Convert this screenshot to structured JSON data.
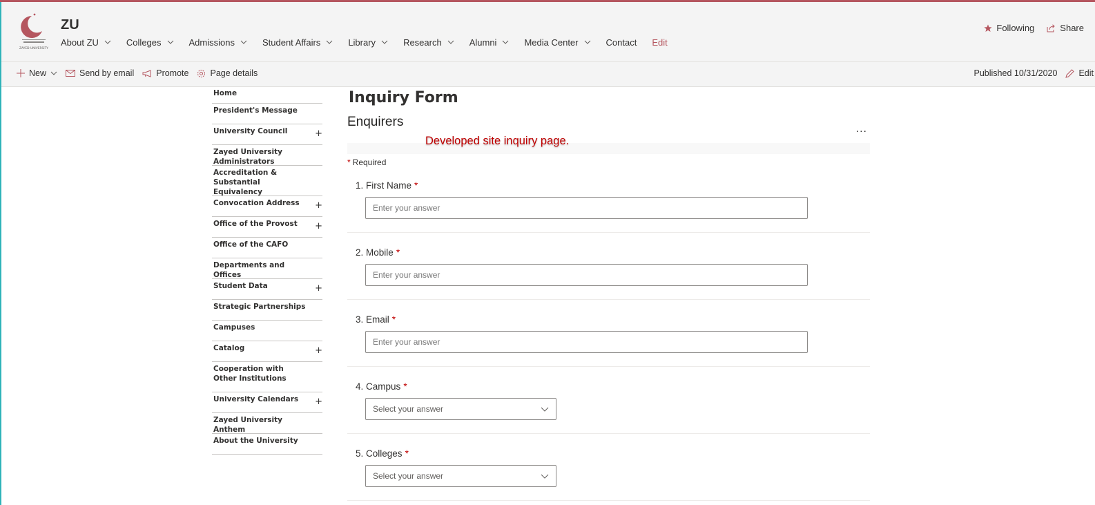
{
  "site": {
    "logo_caption": "ZAYED UNIVERSITY",
    "title": "ZU"
  },
  "nav": {
    "items": [
      {
        "label": "About ZU",
        "dropdown": true
      },
      {
        "label": "Colleges",
        "dropdown": true
      },
      {
        "label": "Admissions",
        "dropdown": true
      },
      {
        "label": "Student Affairs",
        "dropdown": true
      },
      {
        "label": "Library",
        "dropdown": true
      },
      {
        "label": "Research",
        "dropdown": true
      },
      {
        "label": "Alumni",
        "dropdown": true
      },
      {
        "label": "Media Center",
        "dropdown": true
      },
      {
        "label": "Contact",
        "dropdown": false
      }
    ],
    "edit_label": "Edit"
  },
  "header_actions": {
    "following": "Following",
    "share": "Share"
  },
  "commandbar": {
    "new": "New",
    "send_by_email": "Send by email",
    "promote": "Promote",
    "page_details": "Page details",
    "published": "Published 10/31/2020",
    "edit": "Edit"
  },
  "quicklaunch": [
    {
      "label": "Home",
      "expandable": false
    },
    {
      "label": "President's Message",
      "expandable": false
    },
    {
      "label": "University Council",
      "expandable": true
    },
    {
      "label": "Zayed University Administrators",
      "expandable": false
    },
    {
      "label": "Accreditation & Substantial Equivalency",
      "expandable": false
    },
    {
      "label": "Convocation Address",
      "expandable": true
    },
    {
      "label": "Office of the Provost",
      "expandable": true
    },
    {
      "label": "Office of the CAFO",
      "expandable": false
    },
    {
      "label": "Departments and Offices",
      "expandable": false
    },
    {
      "label": "Student Data",
      "expandable": true
    },
    {
      "label": "Strategic Partnerships",
      "expandable": false
    },
    {
      "label": "Campuses",
      "expandable": false
    },
    {
      "label": "Catalog",
      "expandable": true
    },
    {
      "label": "Cooperation with Other Institutions",
      "expandable": false
    },
    {
      "label": "University Calendars",
      "expandable": true
    },
    {
      "label": "Zayed University Anthem",
      "expandable": false
    },
    {
      "label": "About the University",
      "expandable": false
    }
  ],
  "page": {
    "heading": "Inquiry Form",
    "form_title": "Enquirers",
    "more_label": "...",
    "dev_note": "Developed site inquiry page.",
    "required_marker": "*",
    "required_label": "Required"
  },
  "form": {
    "questions": [
      {
        "number": "1.",
        "label": "First Name",
        "type": "text",
        "placeholder": "Enter your answer"
      },
      {
        "number": "2.",
        "label": "Mobile",
        "type": "text",
        "placeholder": "Enter your answer"
      },
      {
        "number": "3.",
        "label": "Email",
        "type": "text",
        "placeholder": "Enter your answer"
      },
      {
        "number": "4.",
        "label": "Campus",
        "type": "select",
        "placeholder": "Select your answer"
      },
      {
        "number": "5.",
        "label": "Colleges",
        "type": "select",
        "placeholder": "Select your answer"
      }
    ],
    "required_star": "*"
  },
  "colors": {
    "accent": "#b5565f",
    "required": "#c00000",
    "left_border": "#2fb3b9"
  }
}
